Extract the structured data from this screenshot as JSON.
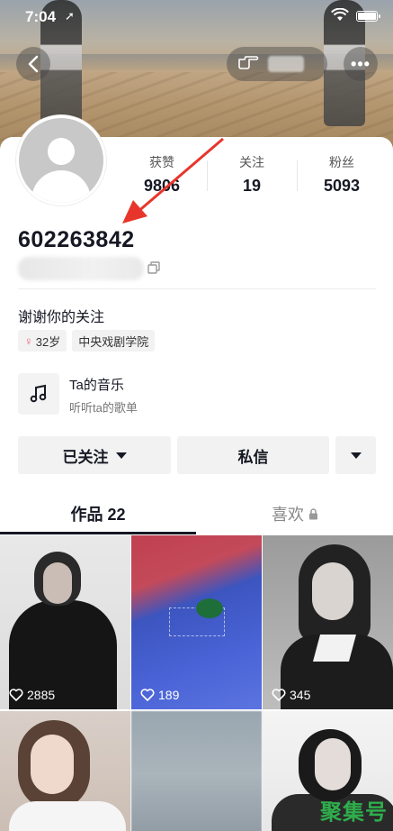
{
  "status_bar": {
    "time": "7:04"
  },
  "profile": {
    "username": "602263842",
    "stats": [
      {
        "label": "获赞",
        "value": "9806"
      },
      {
        "label": "关注",
        "value": "19"
      },
      {
        "label": "粉丝",
        "value": "5093"
      }
    ],
    "bio": "谢谢你的关注",
    "tags": {
      "age": "32岁",
      "school": "中央戏剧学院"
    }
  },
  "music": {
    "title": "Ta的音乐",
    "subtitle": "听听ta的歌单"
  },
  "actions": {
    "follow_label": "已关注",
    "message_label": "私信"
  },
  "tabs": {
    "works_label": "作品 22",
    "likes_label": "喜欢"
  },
  "videos": [
    {
      "likes": "2885"
    },
    {
      "likes": "189"
    },
    {
      "likes": "345"
    }
  ],
  "watermark": "聚集号",
  "colors": {
    "accent_female": "#f25f7a",
    "watermark": "#2fae4c",
    "annotation_arrow": "#e8352b"
  }
}
